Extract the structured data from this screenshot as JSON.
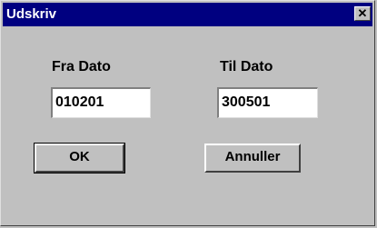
{
  "window": {
    "title": "Udskriv",
    "close_icon": "close-icon"
  },
  "from_date": {
    "label": "Fra Dato",
    "value": "010201"
  },
  "to_date": {
    "label": "Til Dato",
    "value": "300501"
  },
  "buttons": {
    "ok_label": "OK",
    "cancel_label": "Annuller"
  }
}
